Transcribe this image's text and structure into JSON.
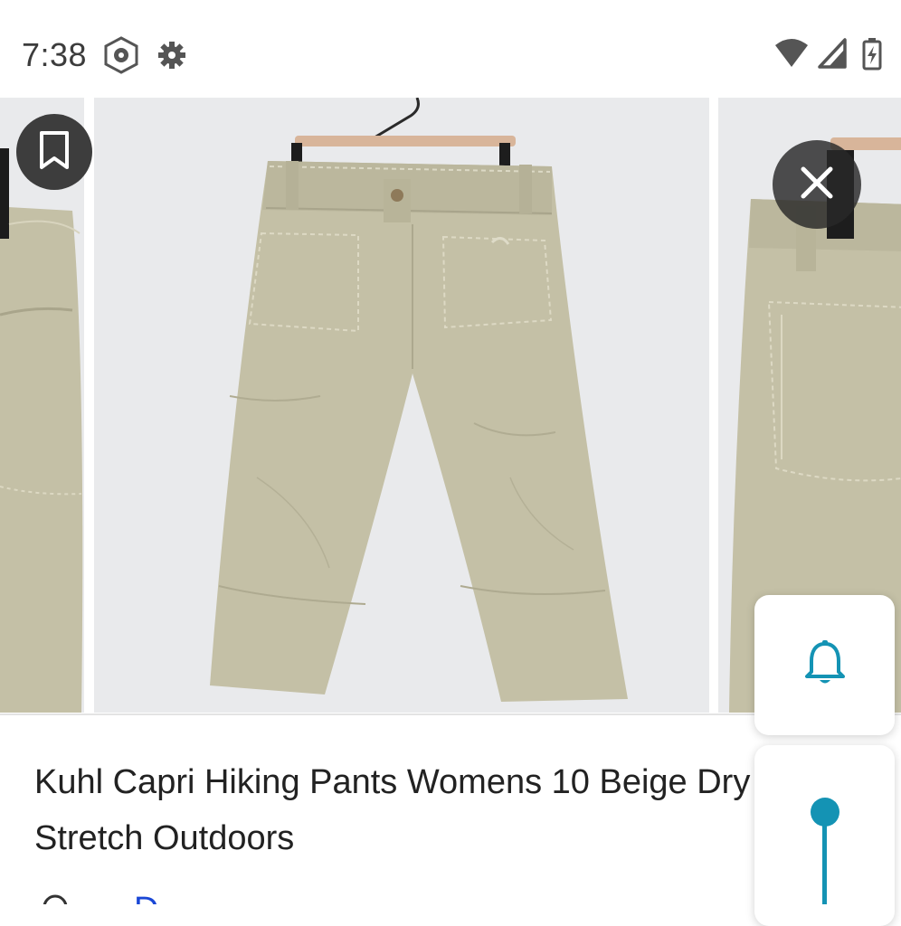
{
  "status_bar": {
    "time": "7:38",
    "left_icons": [
      "shield-hex-icon",
      "gear-icon"
    ],
    "right_icons": [
      "wifi-icon",
      "signal-icon",
      "battery-charging-icon"
    ]
  },
  "gallery": {
    "left_action_icon": "bookmark-icon",
    "right_action_icon": "close-icon"
  },
  "product": {
    "title": "Kuhl Capri Hiking Pants Womens 10 Beige Dry Stretch Outdoors",
    "link_partial": "D"
  },
  "floating": {
    "bell_icon": "bell-icon",
    "pin_icon": "pin-icon",
    "accent_color": "#1493b4"
  },
  "colors": {
    "pants": "#c4c0a6",
    "photo_bg": "#e9eaec",
    "accent": "#1493b4"
  }
}
